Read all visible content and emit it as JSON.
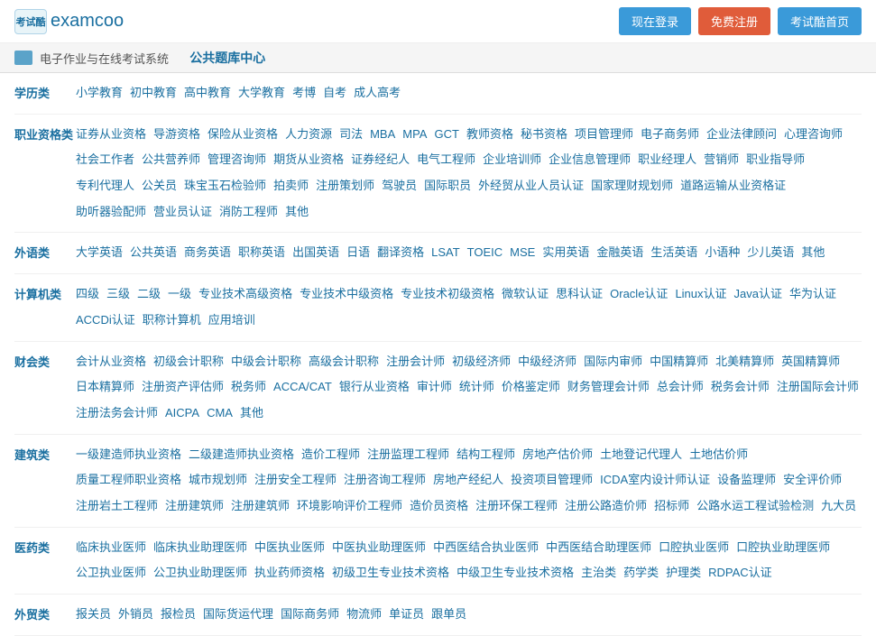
{
  "header": {
    "logo_icon": "考试酷",
    "logo_text": "examcoo",
    "btn_login": "现在登录",
    "btn_register": "免费注册",
    "btn_home": "考试酷首页"
  },
  "sub_header": {
    "breadcrumb_link": "电子作业与在线考试系统",
    "separator": "",
    "current_page": "公共题库中心"
  },
  "categories": [
    {
      "label": "学历类",
      "items": [
        "小学教育",
        "初中教育",
        "高中教育",
        "大学教育",
        "考博",
        "自考",
        "成人高考"
      ]
    },
    {
      "label": "职业资格类",
      "items": [
        "证券从业资格",
        "导游资格",
        "保险从业资格",
        "人力资源",
        "司法",
        "MBA",
        "MPA",
        "GCT",
        "教师资格",
        "秘书资格",
        "项目管理师",
        "电子商务师",
        "企业法律顾问",
        "心理咨询师",
        "社会工作者",
        "公共营养师",
        "管理咨询师",
        "期货从业资格",
        "证券经纪人",
        "电气工程师",
        "企业培训师",
        "企业信息管理师",
        "职业经理人",
        "营销师",
        "职业指导师",
        "专利代理人",
        "公关员",
        "珠宝玉石检验师",
        "拍卖师",
        "注册策划师",
        "驾驶员",
        "国际职员",
        "外经贸从业人员认证",
        "国家理财规划师",
        "道路运输从业资格证",
        "助听器验配师",
        "营业员认证",
        "消防工程师",
        "其他"
      ]
    },
    {
      "label": "外语类",
      "items": [
        "大学英语",
        "公共英语",
        "商务英语",
        "职称英语",
        "出国英语",
        "日语",
        "翻译资格",
        "LSAT",
        "TOEIC",
        "MSE",
        "实用英语",
        "金融英语",
        "生活英语",
        "小语种",
        "少儿英语",
        "其他"
      ]
    },
    {
      "label": "计算机类",
      "items": [
        "四级",
        "三级",
        "二级",
        "一级",
        "专业技术高级资格",
        "专业技术中级资格",
        "专业技术初级资格",
        "微软认证",
        "思科认证",
        "Oracle认证",
        "Linux认证",
        "Java认证",
        "华为认证",
        "ACCDi认证",
        "职称计算机",
        "应用培训"
      ]
    },
    {
      "label": "财会类",
      "items": [
        "会计从业资格",
        "初级会计职称",
        "中级会计职称",
        "高级会计职称",
        "注册会计师",
        "初级经济师",
        "中级经济师",
        "国际内审师",
        "中国精算师",
        "北美精算师",
        "英国精算师",
        "日本精算师",
        "注册资产评估师",
        "税务师",
        "ACCA/CAT",
        "银行从业资格",
        "审计师",
        "统计师",
        "价格鉴定师",
        "财务管理会计师",
        "总会计师",
        "税务会计师",
        "注册国际会计师",
        "注册法务会计师",
        "AICPA",
        "CMA",
        "其他"
      ]
    },
    {
      "label": "建筑类",
      "items": [
        "一级建造师执业资格",
        "二级建造师执业资格",
        "造价工程师",
        "注册监理工程师",
        "结构工程师",
        "房地产估价师",
        "土地登记代理人",
        "土地估价师",
        "质量工程师职业资格",
        "城市规划师",
        "注册安全工程师",
        "注册咨询工程师",
        "房地产经纪人",
        "投资项目管理师",
        "ICDA室内设计师认证",
        "设备监理师",
        "安全评价师",
        "注册岩土工程师",
        "注册建筑师",
        "注册建筑师",
        "环境影响评价工程师",
        "造价员资格",
        "注册环保工程师",
        "注册公路造价师",
        "招标师",
        "公路水运工程试验检测",
        "九大员"
      ]
    },
    {
      "label": "医药类",
      "items": [
        "临床执业医师",
        "临床执业助理医师",
        "中医执业医师",
        "中医执业助理医师",
        "中西医结合执业医师",
        "中西医结合助理医师",
        "口腔执业医师",
        "口腔执业助理医师",
        "公卫执业医师",
        "公卫执业助理医师",
        "执业药师资格",
        "初级卫生专业技术资格",
        "中级卫生专业技术资格",
        "主治类",
        "药学类",
        "护理类",
        "RDPAC认证"
      ]
    },
    {
      "label": "外贸类",
      "items": [
        "报关员",
        "外销员",
        "报检员",
        "国际货运代理",
        "国际商务师",
        "物流师",
        "单证员",
        "跟单员"
      ]
    }
  ]
}
